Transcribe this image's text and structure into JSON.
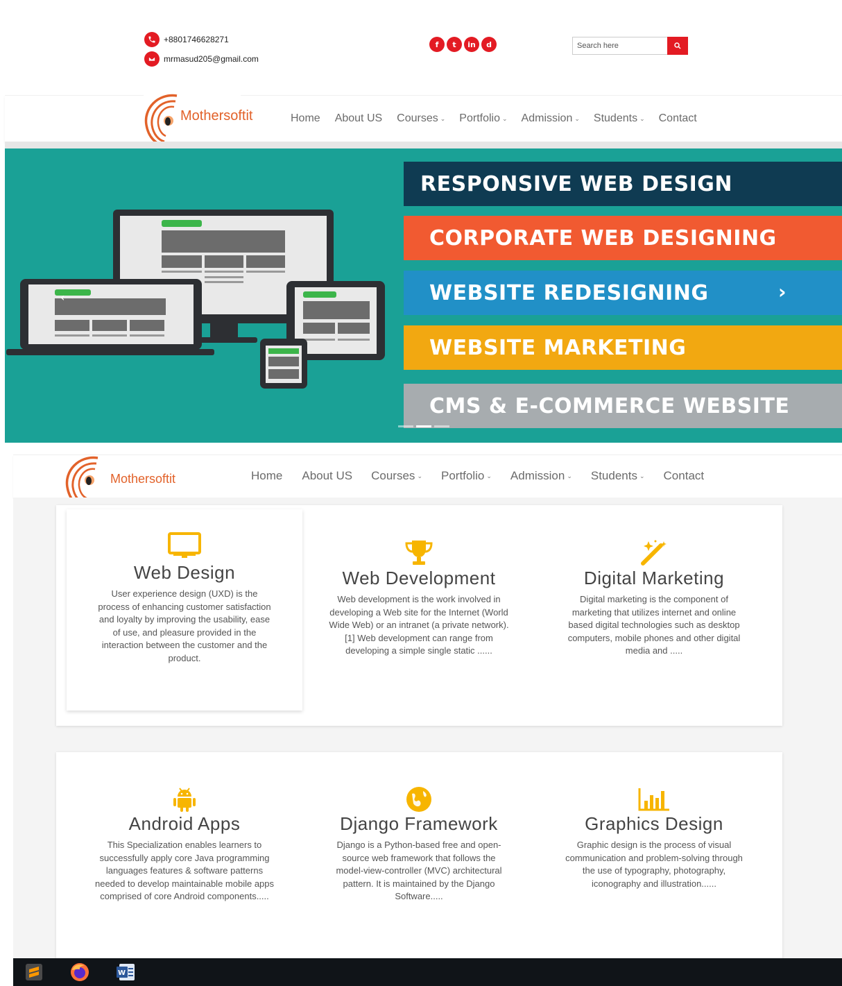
{
  "topbar": {
    "phone": "+8801746628271",
    "email": "mrmasud205@gmail.com",
    "social": [
      "f",
      "t",
      "in",
      "d"
    ],
    "search_placeholder": "Search here"
  },
  "brand": {
    "name": "Mothersoftit"
  },
  "nav": [
    {
      "label": "Home",
      "dropdown": false
    },
    {
      "label": "About US",
      "dropdown": false
    },
    {
      "label": "Courses",
      "dropdown": true
    },
    {
      "label": "Portfolio",
      "dropdown": true
    },
    {
      "label": "Admission",
      "dropdown": true
    },
    {
      "label": "Students",
      "dropdown": true
    },
    {
      "label": "Contact",
      "dropdown": false
    }
  ],
  "hero": {
    "banners": [
      {
        "text": "RESPONSIVE WEB DESIGN",
        "color": "#0f3b52"
      },
      {
        "text": "CORPORATE WEB DESIGNING",
        "color": "#f15a31"
      },
      {
        "text": "WEBSITE REDESIGNING",
        "color": "#2190c7"
      },
      {
        "text": "WEBSITE MARKETING",
        "color": "#f2a811"
      },
      {
        "text": "CMS & E-COMMERCE WEBSITE",
        "color": "#a7acaf"
      }
    ],
    "next_arrow": "›",
    "bg_color": "#1aa196"
  },
  "services": [
    {
      "title": "Web Design",
      "icon": "monitor-icon",
      "desc": "User experience design (UXD) is the process of enhancing customer satisfaction and loyalty by improving the usability, ease of use, and pleasure provided in the interaction between the customer and the product."
    },
    {
      "title": "Web Development",
      "icon": "trophy-icon",
      "desc": "Web development is the work involved in developing a Web site for the Internet (World Wide Web) or an intranet (a private network).[1] Web development can range from developing a simple single static ......"
    },
    {
      "title": "Digital Marketing",
      "icon": "magic-wand-icon",
      "desc": "Digital marketing is the component of marketing that utilizes internet and online based digital technologies such as desktop computers, mobile phones and other digital media and ....."
    },
    {
      "title": "Android Apps",
      "icon": "android-icon",
      "desc": "This Specialization enables learners to successfully apply core Java programming languages features & software patterns needed to develop maintainable mobile apps comprised of core Android components....."
    },
    {
      "title": "Django Framework",
      "icon": "globe-icon",
      "desc": "Django is a Python-based free and open-source web framework that follows the model-view-controller (MVC) architectural pattern. It is maintained by the Django Software....."
    },
    {
      "title": "Graphics Design",
      "icon": "bar-chart-icon",
      "desc": "Graphic design is the process of visual communication and problem-solving through the use of typography, photography, iconography and illustration......"
    }
  ],
  "colors": {
    "accent": "#e31b23",
    "icon_yellow": "#f7b500",
    "brand_orange": "#e2622a"
  },
  "taskbar": [
    "sublime-text-icon",
    "firefox-icon",
    "word-icon"
  ]
}
